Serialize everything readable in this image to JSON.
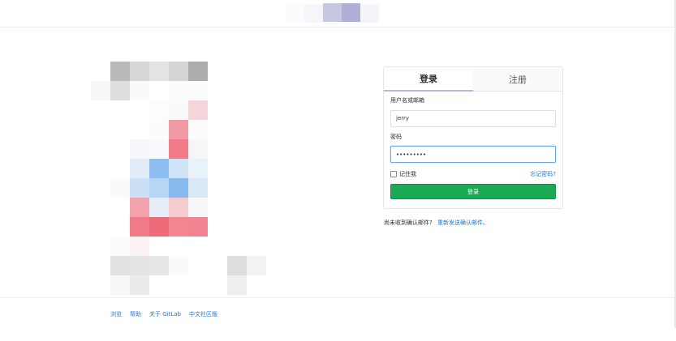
{
  "login": {
    "tab_login": "登录",
    "tab_register": "注册",
    "username_label": "用户名或邮箱",
    "username_value": "jerry",
    "password_label": "密码",
    "password_value": "•••••••••",
    "remember_label": "记住我",
    "forgot_link": "忘记密码?",
    "submit_label": "登录"
  },
  "confirm": {
    "text": "尚未收到确认邮件?",
    "link": "重新发送确认邮件。"
  },
  "footer": {
    "links": [
      "浏览",
      "帮助",
      "关于 GitLab",
      "中文社区版"
    ]
  },
  "colors": {
    "primary_button": "#1aaa55",
    "link": "#1f78d1",
    "active_tab_underline": "#b8b6dd"
  }
}
